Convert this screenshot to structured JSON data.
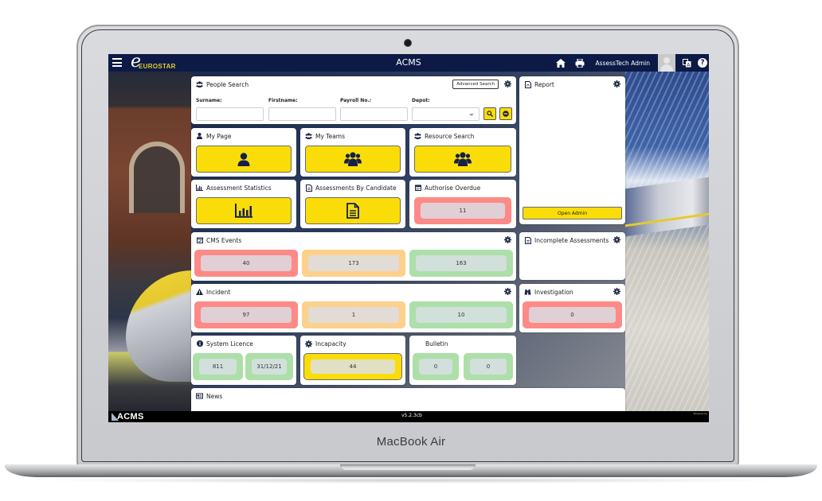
{
  "device": {
    "model_label": "MacBook Air"
  },
  "topbar": {
    "brand_mark": "e",
    "brand_name": "EUROSTAR",
    "app_title": "ACMS",
    "user_name": "AssessTech Admin",
    "icons": [
      "menu-icon",
      "home-icon",
      "print-icon",
      "avatar",
      "translate-icon",
      "help-icon"
    ],
    "help_glyph": "?"
  },
  "people_search": {
    "title": "People Search",
    "advanced_search_label": "Advanced Search",
    "fields": [
      {
        "label": "Surname:",
        "value": "",
        "placeholder": ""
      },
      {
        "label": "Firstname:",
        "value": "",
        "placeholder": ""
      },
      {
        "label": "Payroll No.:",
        "value": "",
        "placeholder": ""
      }
    ],
    "depot": {
      "label": "Depot:",
      "selected": ""
    }
  },
  "report": {
    "title": "Report",
    "open_admin_label": "Open Admin"
  },
  "my_page": {
    "title": "My Page"
  },
  "my_teams": {
    "title": "My Teams"
  },
  "resource_search": {
    "title": "Resource Search"
  },
  "assessment_statistics": {
    "title": "Assessment Statistics"
  },
  "assessments_by_candidate": {
    "title": "Assessments By Candidate"
  },
  "authorise_overdue": {
    "title": "Authorise Overdue",
    "value": "11",
    "status": "red"
  },
  "cms_events": {
    "title": "CMS Events",
    "values": [
      {
        "value": "40",
        "status": "red"
      },
      {
        "value": "173",
        "status": "orange"
      },
      {
        "value": "163",
        "status": "green"
      }
    ]
  },
  "incomplete_assessments": {
    "title": "Incomplete Assessments"
  },
  "incident": {
    "title": "Incident",
    "values": [
      {
        "value": "97",
        "status": "red"
      },
      {
        "value": "1",
        "status": "orange"
      },
      {
        "value": "10",
        "status": "green"
      }
    ]
  },
  "investigation": {
    "title": "Investigation",
    "value": "0",
    "status": "red"
  },
  "system_licence": {
    "title": "System Licence",
    "values": [
      {
        "value": "811",
        "status": "green"
      },
      {
        "value": "31/12/21",
        "status": "green"
      }
    ]
  },
  "incapacity": {
    "title": "Incapacity",
    "value": "44",
    "status": "yellow"
  },
  "bulletin": {
    "title": "Bulletin",
    "values": [
      {
        "value": "0",
        "status": "green"
      },
      {
        "value": "0",
        "status": "green"
      }
    ]
  },
  "news": {
    "title": "News"
  },
  "footer": {
    "logo_text": "ACMS",
    "version": "v5.2.3cb",
    "powered_by": "Powered by",
    "vendor": "AssessTech"
  },
  "colors": {
    "topbar": "#0c1a45",
    "accent_yellow": "#fadd08",
    "status_red": "#fd8a86",
    "status_orange": "#fdd08c",
    "status_green": "#addfa9"
  }
}
